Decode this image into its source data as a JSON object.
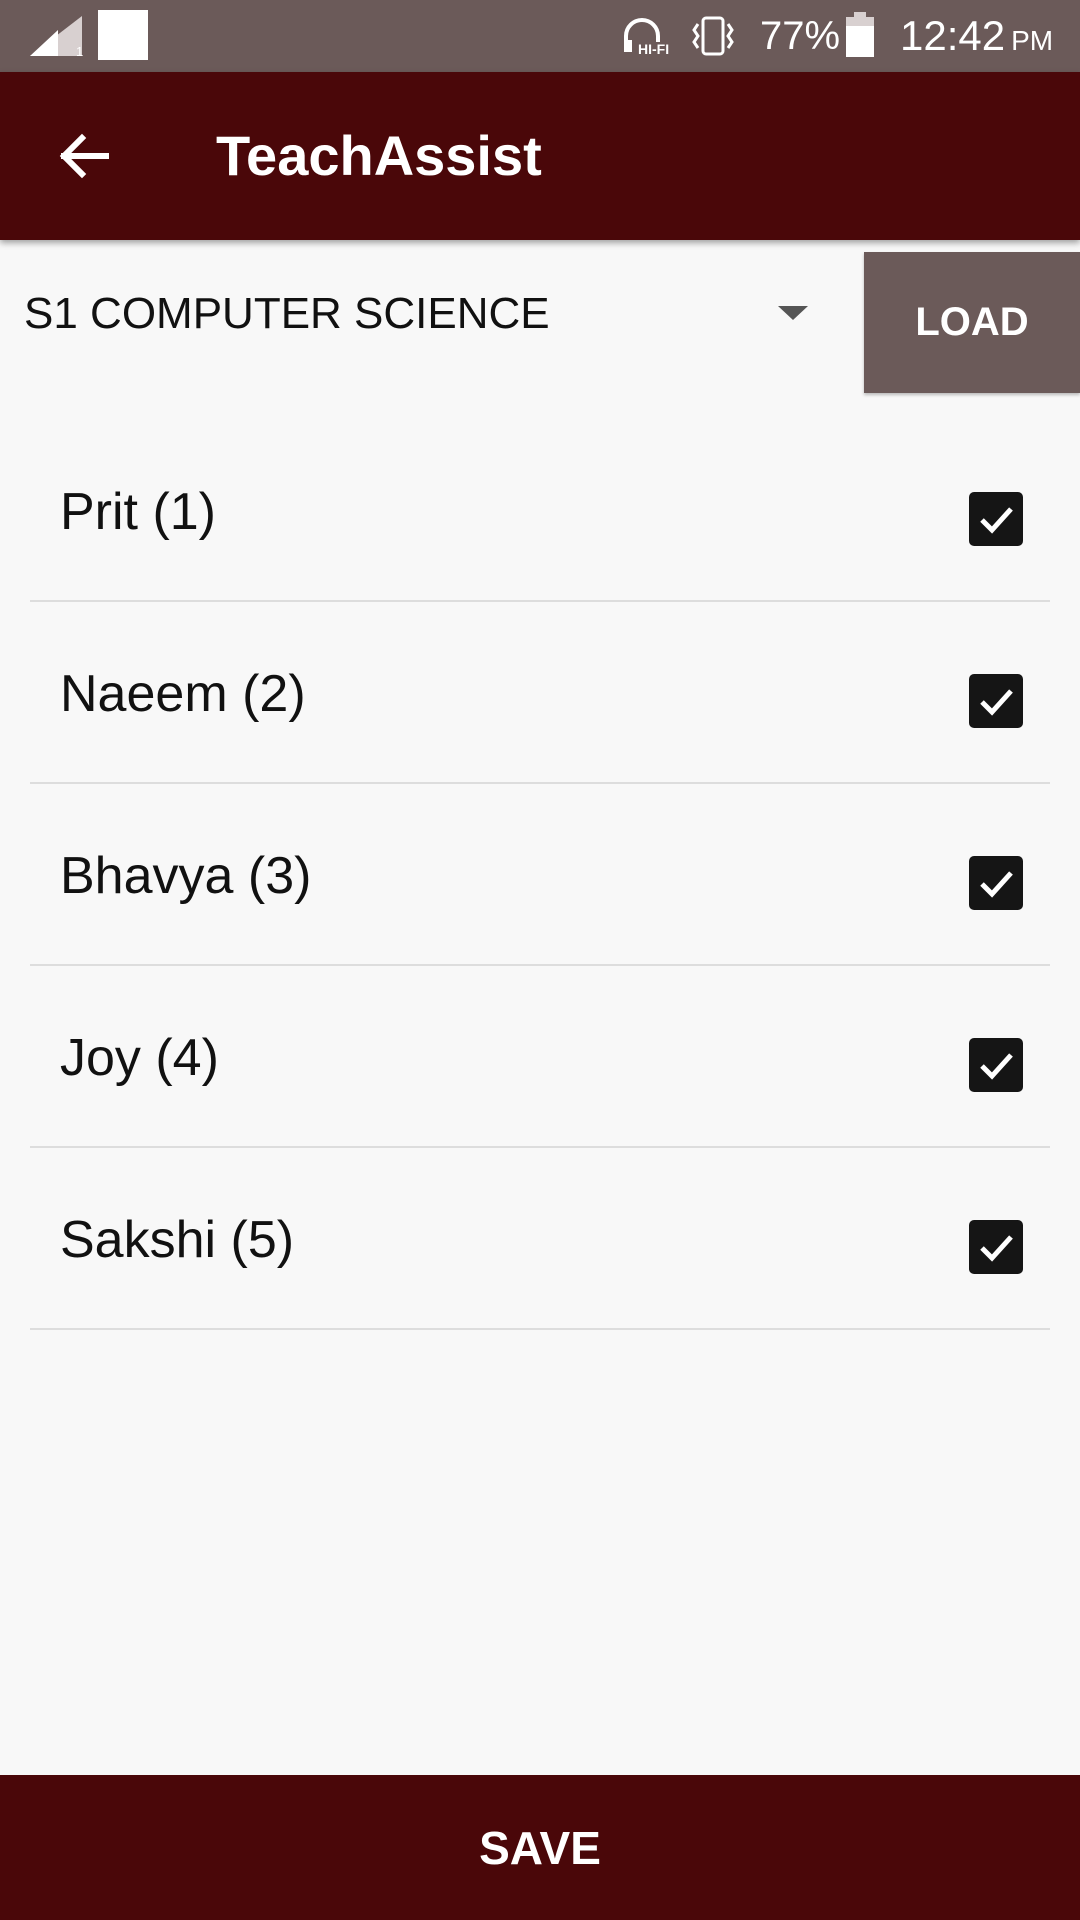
{
  "status_bar": {
    "battery_percent": "77%",
    "time": "12:42",
    "ampm": "PM",
    "sim_slot": "1",
    "icons": [
      "signal-icon",
      "notification-icon",
      "hifi-headphones-icon",
      "vibrate-icon",
      "battery-icon"
    ]
  },
  "app_bar": {
    "title": "TeachAssist",
    "back_icon": "arrow-left-icon"
  },
  "course_selector": {
    "selected": "S1 COMPUTER SCIENCE",
    "load_label": "LOAD"
  },
  "students": [
    {
      "label": "Prit (1)",
      "checked": true
    },
    {
      "label": "Naeem (2)",
      "checked": true
    },
    {
      "label": "Bhavya (3)",
      "checked": true
    },
    {
      "label": "Joy (4)",
      "checked": true
    },
    {
      "label": "Sakshi (5)",
      "checked": true
    }
  ],
  "footer": {
    "save_label": "SAVE"
  },
  "colors": {
    "primary": "#4a0709",
    "status_bar": "#6b5a59",
    "load_button": "#6b5a59",
    "checkbox": "#151515",
    "background": "#f8f8f8"
  }
}
